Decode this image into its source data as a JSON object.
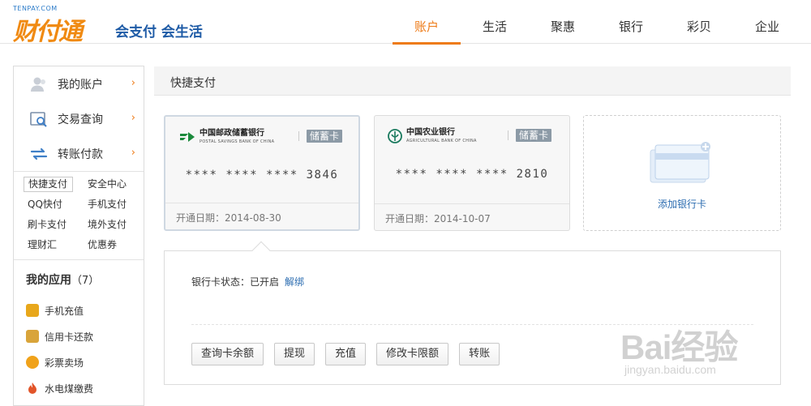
{
  "header": {
    "logo_small": "TENPAY.COM",
    "logo_main": "财付通",
    "logo_slogan": "会支付 会生活",
    "nav": [
      "账户",
      "生活",
      "聚惠",
      "银行",
      "彩贝",
      "企业"
    ],
    "active_nav": "账户"
  },
  "sidebar": {
    "menu": [
      {
        "label": "我的账户",
        "icon": "user-icon"
      },
      {
        "label": "交易查询",
        "icon": "search-records-icon"
      },
      {
        "label": "转账付款",
        "icon": "transfer-icon"
      }
    ],
    "arrow": "›",
    "sub_links": [
      "快捷支付",
      "安全中心",
      "QQ快付",
      "手机支付",
      "刷卡支付",
      "境外支付",
      "理财汇",
      "优惠券"
    ],
    "active_sub": "快捷支付",
    "apps_title": "我的应用",
    "apps_count": "（7）",
    "apps": [
      {
        "label": "手机充值",
        "icon": "mobile-recharge-icon",
        "color": "#e8a71b"
      },
      {
        "label": "信用卡还款",
        "icon": "credit-card-icon",
        "color": "#d9a43a"
      },
      {
        "label": "彩票卖场",
        "icon": "lottery-icon",
        "color": "#f0a21a"
      },
      {
        "label": "水电煤缴费",
        "icon": "flame-icon",
        "color": "#e2552a"
      }
    ]
  },
  "main": {
    "section_title": "快捷支付",
    "cards": [
      {
        "bank_name": "中国邮政储蓄银行",
        "bank_en": "POSTAL SAVINGS BANK OF CHINA",
        "type": "储蓄卡",
        "number": "**** **** **** 3846",
        "date": "开通日期：2014-08-30",
        "logo_color": "#1b8a3c",
        "selected": true
      },
      {
        "bank_name": "中国农业银行",
        "bank_en": "AGRICULTURAL BANK OF CHINA",
        "type": "储蓄卡",
        "number": "**** **** **** 2810",
        "date": "开通日期：2014-10-07",
        "logo_color": "#1a7a5e",
        "selected": false
      }
    ],
    "add_card_label": "添加银行卡",
    "detail": {
      "status_text": "银行卡状态：已开启",
      "unbind_label": "解绑",
      "actions": [
        "查询卡余额",
        "提现",
        "充值",
        "修改卡限额",
        "转账"
      ]
    }
  },
  "watermark": {
    "main": "Bai经验",
    "sub": "jingyan.baidu.com"
  },
  "colors": {
    "accent": "#ee7b17",
    "link": "#2b6cb0",
    "badge": "#8c9aa6"
  }
}
